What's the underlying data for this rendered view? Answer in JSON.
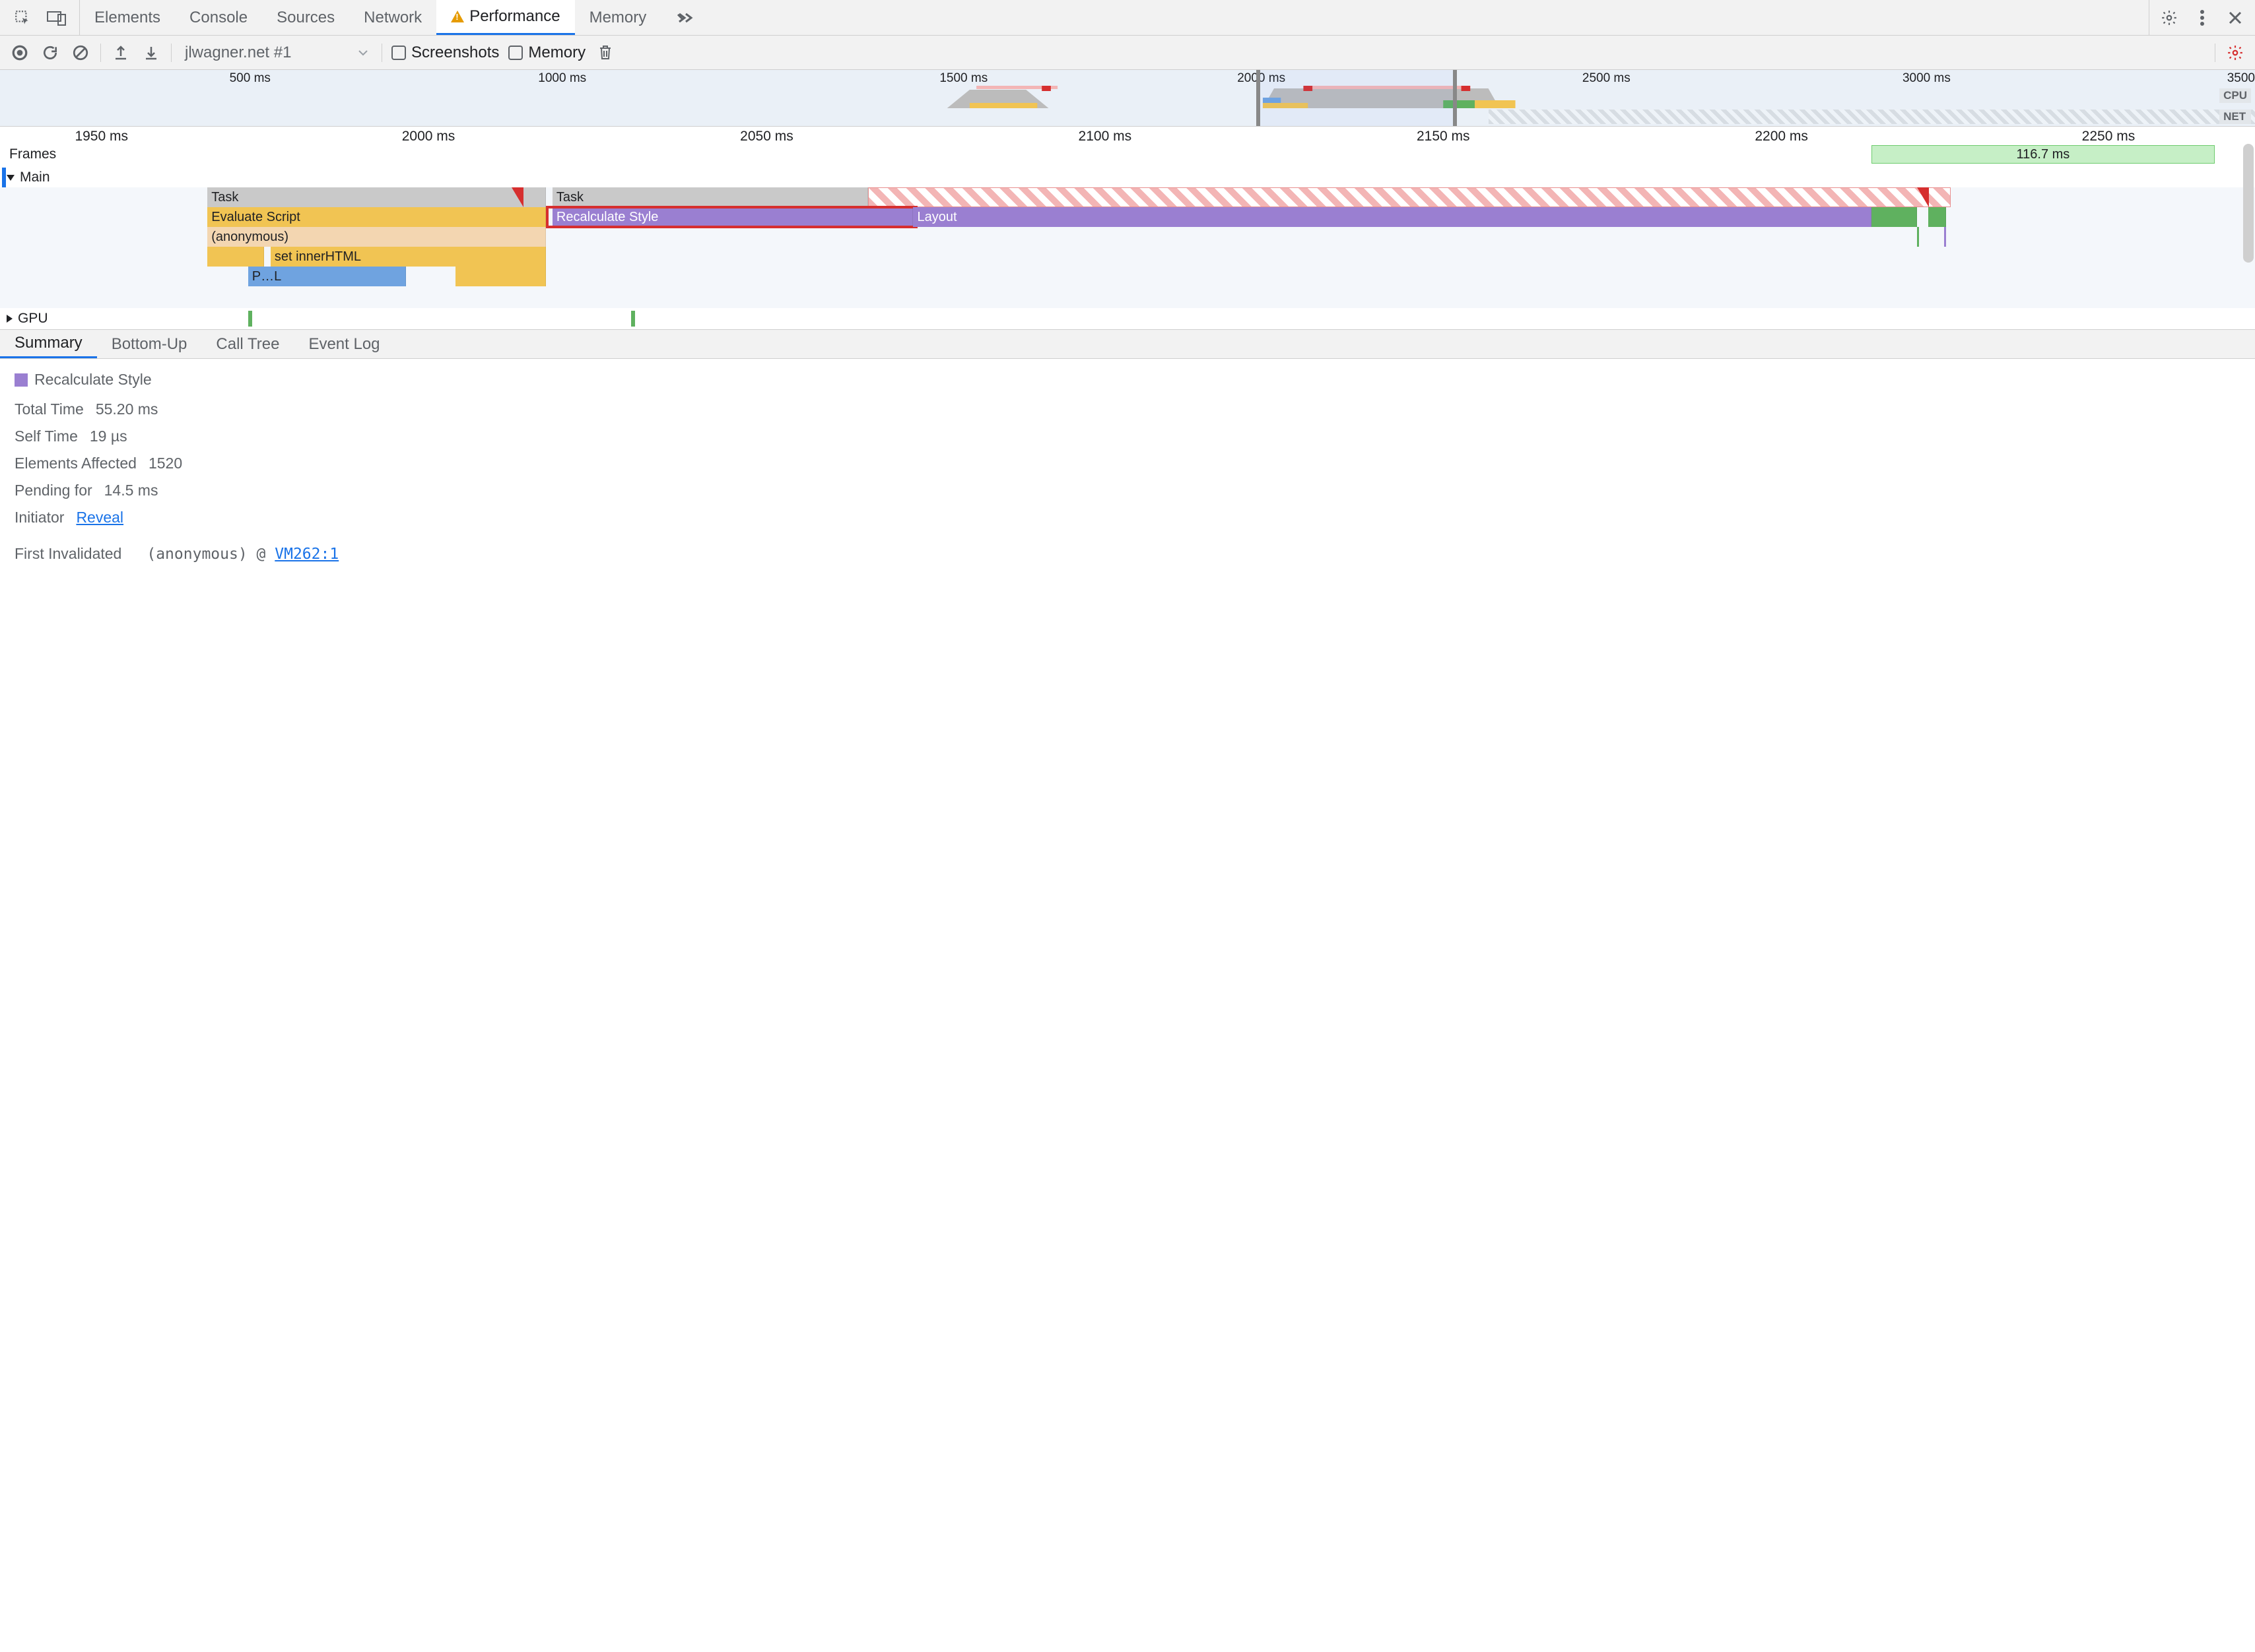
{
  "tabs": {
    "items": [
      "Elements",
      "Console",
      "Sources",
      "Network",
      "Performance",
      "Memory"
    ],
    "selected": "Performance"
  },
  "toolbar": {
    "profile": "jlwagner.net #1",
    "screenshots_label": "Screenshots",
    "memory_label": "Memory"
  },
  "overview": {
    "ticks": [
      "500 ms",
      "1000 ms",
      "1500 ms",
      "2000 ms",
      "2500 ms",
      "3000 ms",
      "3500"
    ],
    "badges": [
      "CPU",
      "NET"
    ],
    "selection_start_ms": 1950,
    "selection_end_ms": 2260,
    "range_ms": 3500
  },
  "detail": {
    "ruler": [
      "1950 ms",
      "2000 ms",
      "2050 ms",
      "2100 ms",
      "2150 ms",
      "2200 ms",
      "2250 ms"
    ],
    "frames_label": "Frames",
    "frame_block": "116.7 ms",
    "main_label": "Main",
    "gpu_label": "GPU",
    "bars": {
      "task1": "Task",
      "task2": "Task",
      "eval": "Evaluate Script",
      "recalc": "Recalculate Style",
      "layout": "Layout",
      "anon": "(anonymous)",
      "inner": "set innerHTML",
      "parse": "P…L"
    }
  },
  "bottom_tabs": [
    "Summary",
    "Bottom-Up",
    "Call Tree",
    "Event Log"
  ],
  "summary": {
    "title": "Recalculate Style",
    "rows": {
      "total_time_k": "Total Time",
      "total_time_v": "55.20 ms",
      "self_time_k": "Self Time",
      "self_time_v": "19 µs",
      "elements_k": "Elements Affected",
      "elements_v": "1520",
      "pending_k": "Pending for",
      "pending_v": "14.5 ms",
      "initiator_k": "Initiator",
      "initiator_link": "Reveal",
      "first_inval_k": "First Invalidated",
      "first_inval_fn": "(anonymous)",
      "first_inval_at": "@",
      "first_inval_src": "VM262:1"
    }
  }
}
